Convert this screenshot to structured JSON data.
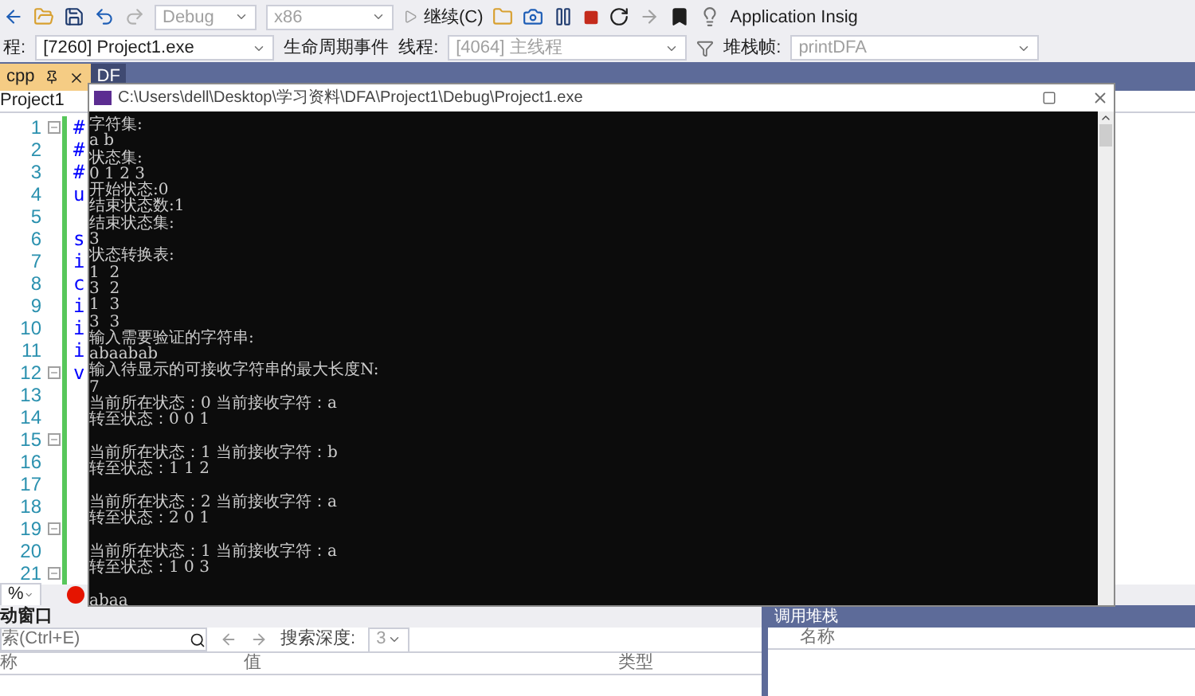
{
  "toolbar": {
    "config": "Debug",
    "platform": "x86",
    "continue": "继续(C)",
    "insights": "Application Insig"
  },
  "debug_bar": {
    "process_label": "程:",
    "process": "[7260] Project1.exe",
    "lifecycle": "生命周期事件",
    "thread_label": "线程:",
    "thread": "[4064] 主线程",
    "frame_label": "堆栈帧:",
    "frame": "printDFA"
  },
  "tabs": [
    {
      "label": "cpp",
      "selected": true
    },
    {
      "label": "DF",
      "selected": false
    }
  ],
  "breadcrumb": "Project1",
  "editor": {
    "lines": [
      {
        "number": "1",
        "code": "#",
        "fold": true
      },
      {
        "number": "2",
        "code": "#",
        "fold": false
      },
      {
        "number": "3",
        "code": "#",
        "fold": false
      },
      {
        "number": "4",
        "code": "u",
        "fold": false
      },
      {
        "number": "5",
        "fold": false
      },
      {
        "number": "6",
        "code": "s",
        "fold": false
      },
      {
        "number": "7",
        "code": "i",
        "fold": false
      },
      {
        "number": "8",
        "code": "c",
        "fold": false
      },
      {
        "number": "9",
        "code": "i",
        "fold": false
      },
      {
        "number": "10",
        "code": "i",
        "fold": false
      },
      {
        "number": "11",
        "code": "i",
        "fold": false
      },
      {
        "number": "12",
        "code": "v",
        "fold": true
      },
      {
        "number": "13",
        "fold": false
      },
      {
        "number": "14",
        "fold": false
      },
      {
        "number": "15",
        "fold": true
      },
      {
        "number": "16",
        "fold": false
      },
      {
        "number": "17",
        "fold": false
      },
      {
        "number": "18",
        "fold": false
      },
      {
        "number": "19",
        "fold": true
      },
      {
        "number": "20",
        "fold": false
      },
      {
        "number": "21",
        "fold": true
      }
    ],
    "zoom": "%"
  },
  "console": {
    "title": "C:\\Users\\dell\\Desktop\\学习资料\\DFA\\Project1\\Debug\\Project1.exe",
    "blocks": [
      [
        "字符集:",
        "a b",
        "状态集:",
        "0 1 2 3",
        "开始状态:0",
        "结束状态数:1",
        "结束状态集:",
        "3",
        "状态转换表:",
        "1  2",
        "3  2",
        "1  3",
        "3  3",
        "输入需要验证的字符串:",
        "abaabab",
        "输入待显示的可接收字符串的最大长度N:",
        "7",
        "当前所在状态：0 当前接收字符：a",
        "转至状态：0 0 1"
      ],
      [
        "当前所在状态：1 当前接收字符：b",
        "转至状态：1 1 2"
      ],
      [
        "当前所在状态：2 当前接收字符：a",
        "转至状态：2 0 1"
      ],
      [
        "当前所在状态：1 当前接收字符：a",
        "转至状态：1 0 3"
      ],
      [
        "abaa"
      ]
    ]
  },
  "autos": {
    "title": "动窗口",
    "search": "索(Ctrl+E)",
    "depth_label": "搜索深度:",
    "depth": "3",
    "columns": [
      "称",
      "值",
      "类型"
    ]
  },
  "call_stack": {
    "title": "调用堆栈",
    "columns": [
      "名称"
    ]
  }
}
